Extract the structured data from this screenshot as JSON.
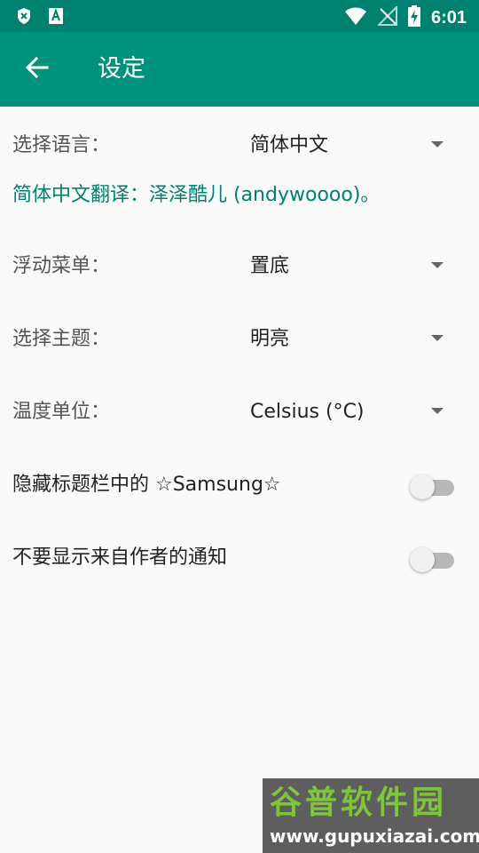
{
  "status_bar": {
    "time": "6:01",
    "icons": [
      "shield-x-icon",
      "font-a-icon",
      "wifi-icon",
      "no-signal-icon",
      "battery-charging-icon"
    ]
  },
  "app_bar": {
    "title": "设定",
    "back_icon": "arrow-left-icon"
  },
  "settings": {
    "language": {
      "label": "选择语言：",
      "value": "简体中文"
    },
    "translator_note": "简体中文翻译：泽泽酷儿 (andywoooo)。",
    "floating_menu": {
      "label": "浮动菜单：",
      "value": "置底"
    },
    "theme": {
      "label": "选择主题：",
      "value": "明亮"
    },
    "temperature_unit": {
      "label": "温度单位：",
      "value": "Celsius (°C)"
    },
    "hide_title": {
      "label": "隐藏标题栏中的 ☆Samsung☆",
      "enabled": false
    },
    "hide_notifications": {
      "label": "不要显示来自作者的通知",
      "enabled": false
    }
  },
  "watermark": {
    "title": "谷普软件园",
    "url": "www.gupuxiazai.com"
  },
  "colors": {
    "status_bar": "#00806f",
    "app_bar": "#00917d",
    "accent_text": "#00806f",
    "background": "#fafafa"
  }
}
